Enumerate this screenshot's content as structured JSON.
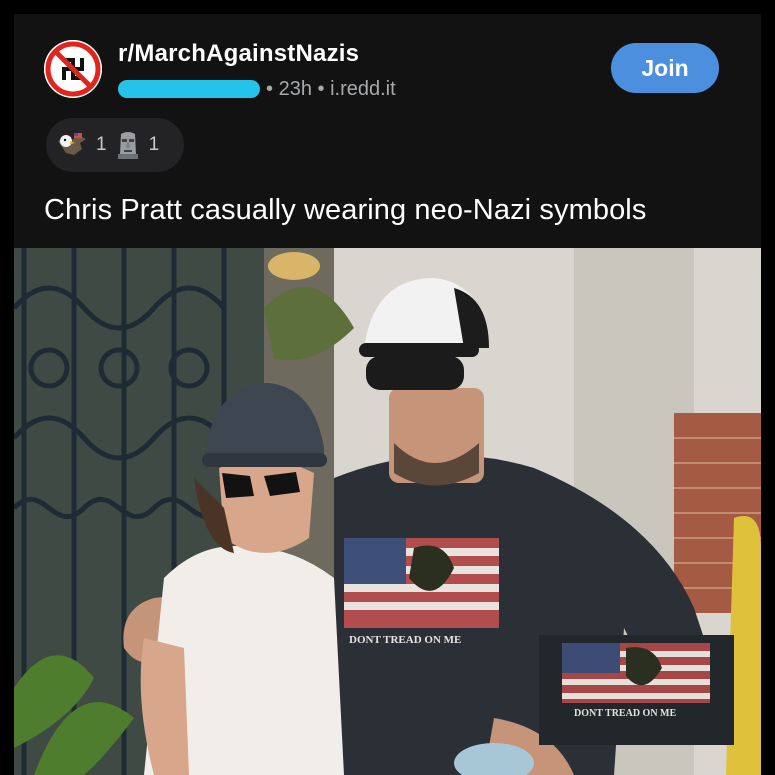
{
  "post": {
    "subreddit": "r/MarchAgainstNazis",
    "time": "23h",
    "separator": "•",
    "domain": "i.redd.it",
    "join_label": "Join",
    "title": "Chris Pratt casually wearing neo-Nazi symbols"
  },
  "awards": [
    {
      "icon": "eagle-award-icon",
      "count": "1"
    },
    {
      "icon": "moai-award-icon",
      "count": "1"
    }
  ],
  "photo": {
    "shirt_text": "DONT TREAD ON ME",
    "inset_text": "DONT TREAD ON ME"
  },
  "colors": {
    "card_bg": "#121213",
    "join_button": "#4c8fdf",
    "redaction": "#25c3ea",
    "meta_text": "#a7a9ab"
  }
}
